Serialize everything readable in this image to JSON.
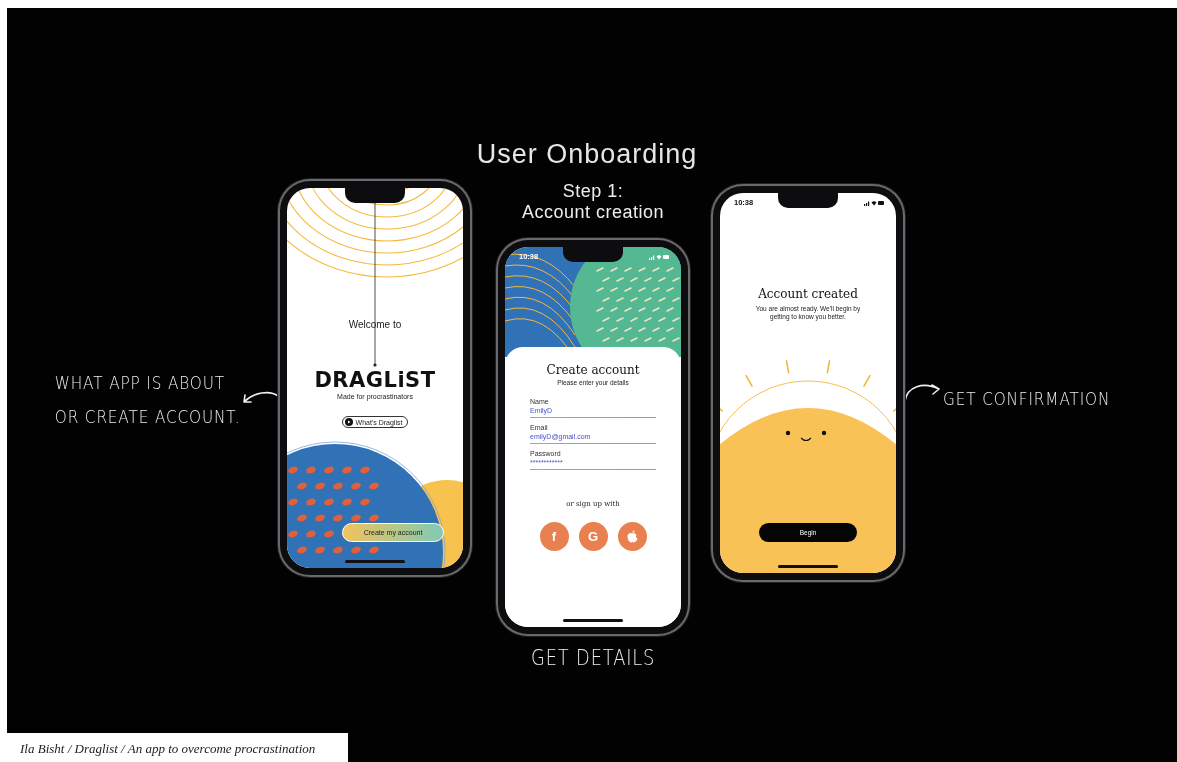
{
  "title": "User Onboarding",
  "screens": [
    {
      "kind": "welcome",
      "annotation": "WHAT APP IS ABOUT\nOR CREATE ACCOUNT.",
      "welcome": "Welcome to",
      "logo": "DRAGLiST",
      "tagline": "Made for procrastinators",
      "info_button": "What's Draglist",
      "cta": "Create my account"
    },
    {
      "kind": "signup",
      "caption": "Step 1:\nAccount creation",
      "status_time": "10:38",
      "annotation": "GET DETAILS",
      "heading": "Create account",
      "subheading": "Please enter your details",
      "fields": [
        {
          "label": "Name",
          "value": "EmilyD"
        },
        {
          "label": "Email",
          "value": "emilyD@gmail.com"
        },
        {
          "label": "Password",
          "value": "************"
        }
      ],
      "alt_label": "or sign up with",
      "social": [
        {
          "kind": "facebook",
          "label": "f"
        },
        {
          "kind": "google",
          "label": "G"
        },
        {
          "kind": "apple"
        }
      ]
    },
    {
      "kind": "confirm",
      "status_time": "10:38",
      "annotation": "GET CONFIRMATION",
      "heading": "Account created",
      "body": "You are almost ready. We'll begin by getting to know you better.",
      "button": "Begin"
    }
  ],
  "credit": "Ila Bisht / Draglist / An app to overcome procrastination"
}
